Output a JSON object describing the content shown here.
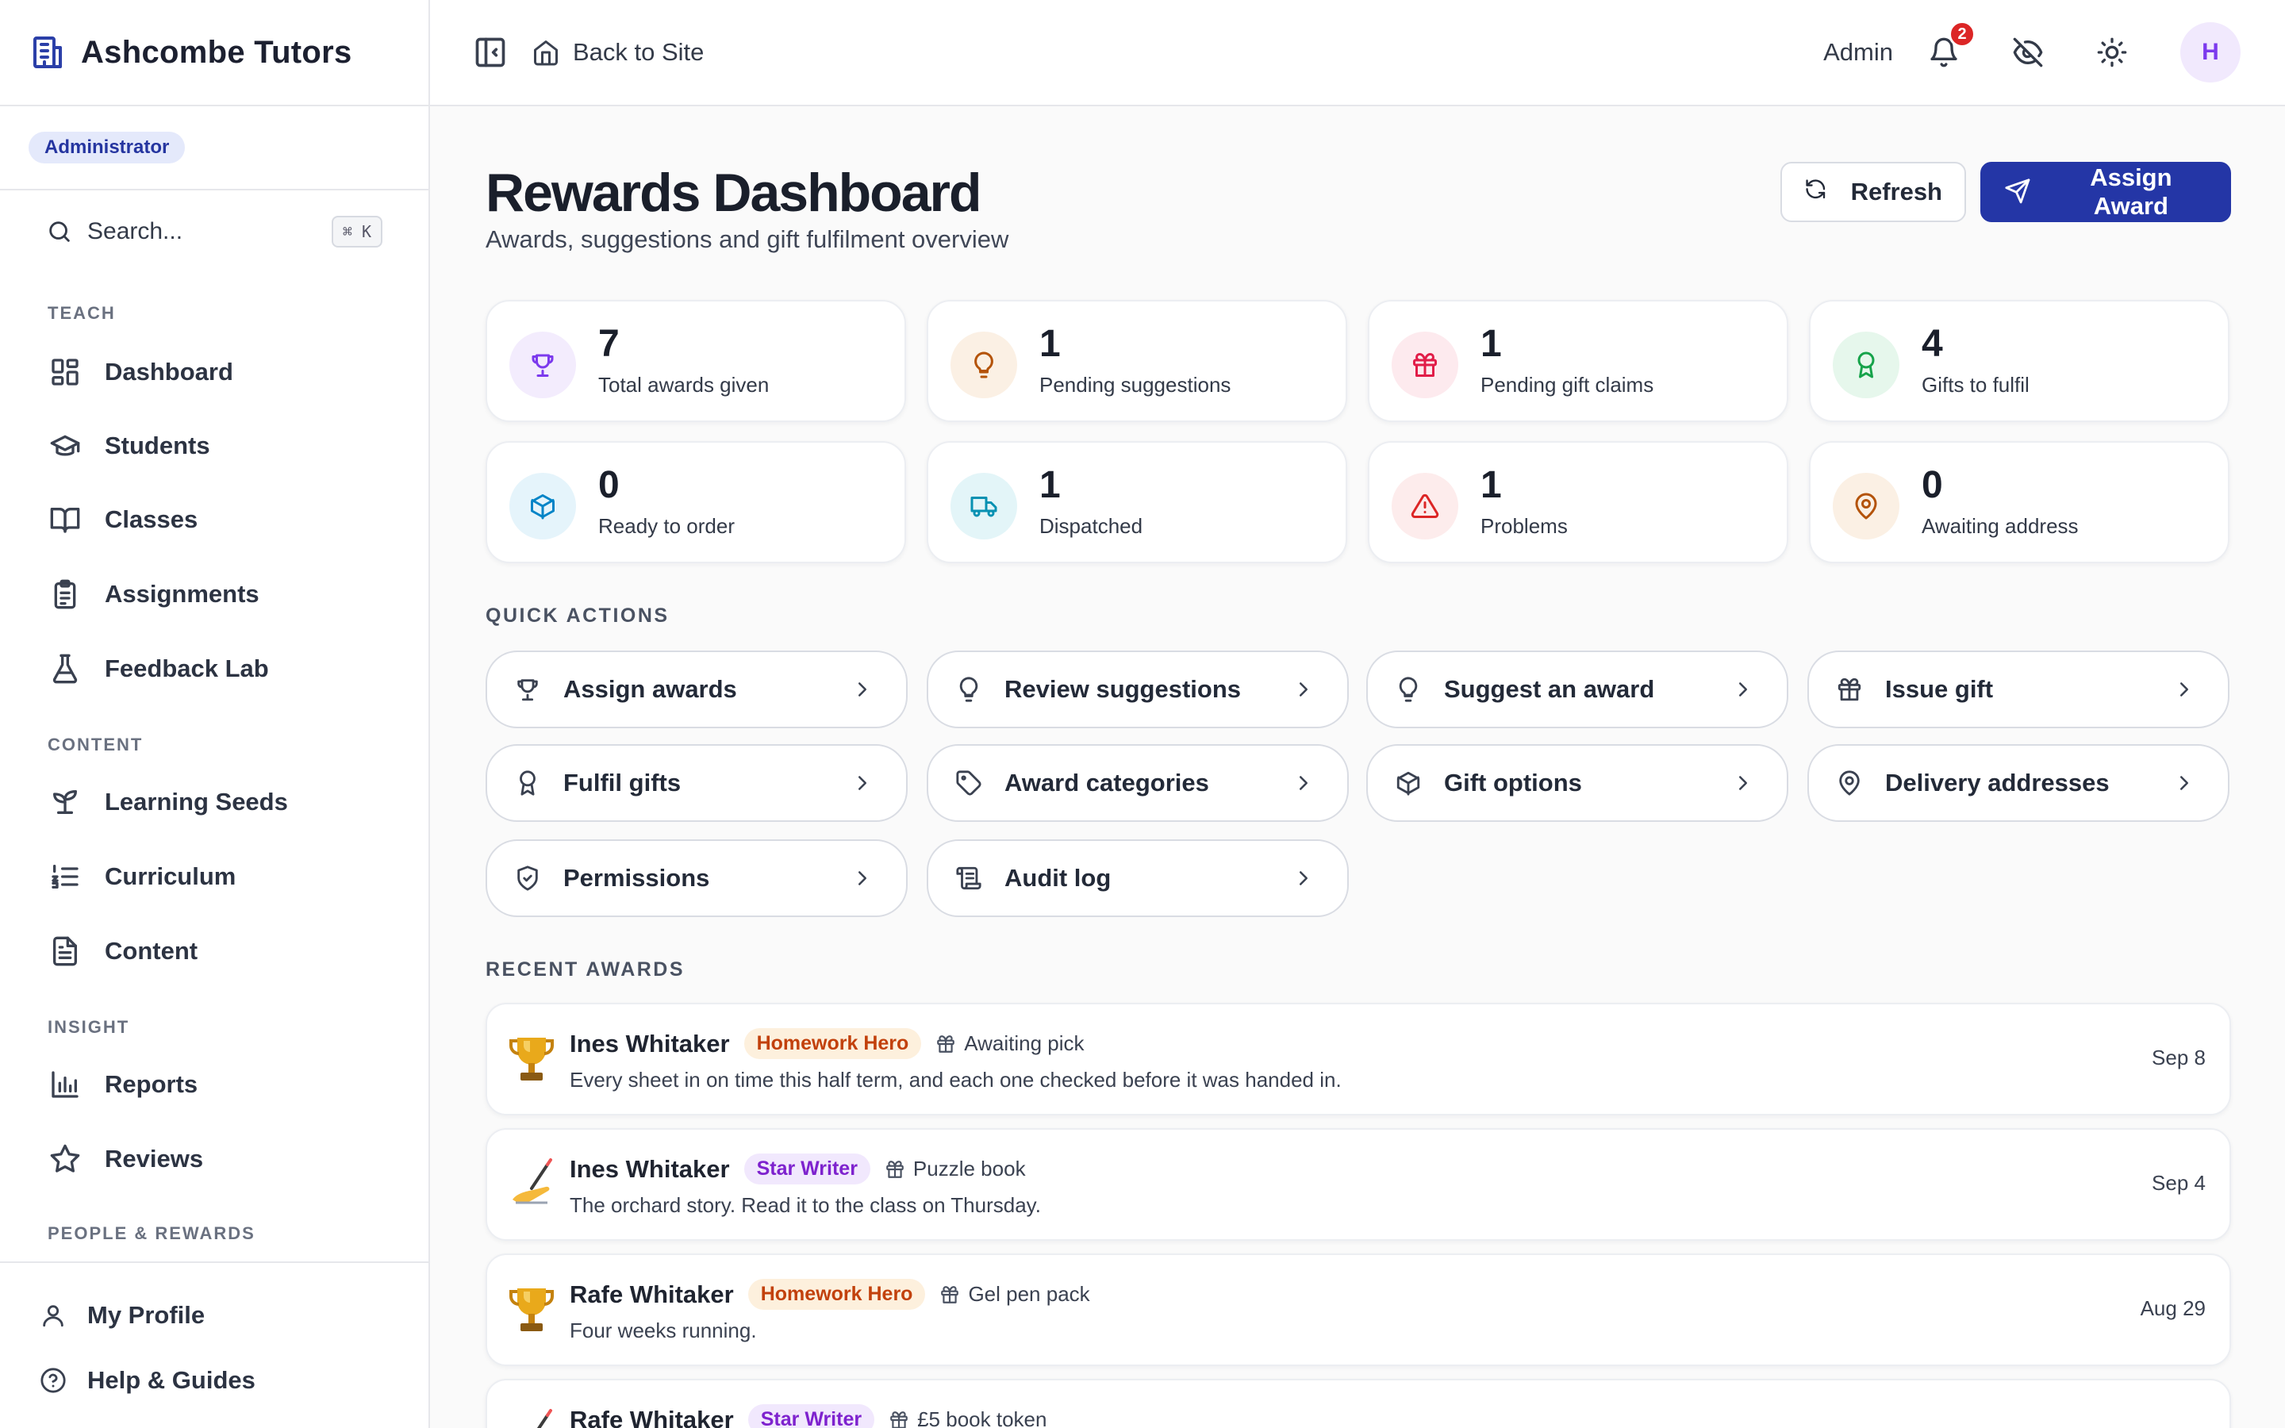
{
  "brand": {
    "name": "Ashcombe Tutors"
  },
  "role_badge": "Administrator",
  "search": {
    "placeholder": "Search...",
    "shortcut": "⌘ K"
  },
  "nav": {
    "sections": [
      "TEACH",
      "CONTENT",
      "INSIGHT",
      "PEOPLE & REWARDS"
    ],
    "items": [
      "Dashboard",
      "Students",
      "Classes",
      "Assignments",
      "Feedback Lab",
      "Learning Seeds",
      "Curriculum",
      "Content",
      "Reports",
      "Reviews"
    ],
    "icons": [
      "layout-grid-icon",
      "graduation-cap-icon",
      "open-book-icon",
      "clipboard-list-icon",
      "flask-icon",
      "sprout-icon",
      "list-ordered-icon",
      "file-text-icon",
      "bar-chart-icon",
      "star-icon"
    ]
  },
  "footer": {
    "profile": "My Profile",
    "help": "Help & Guides"
  },
  "topbar": {
    "back_to_site": "Back to Site",
    "admin_label": "Admin",
    "notification_count": "2",
    "avatar_initial": "H"
  },
  "page": {
    "title": "Rewards Dashboard",
    "subtitle": "Awards, suggestions and gift fulfilment overview"
  },
  "actions": {
    "refresh": "Refresh",
    "assign_award": "Assign Award"
  },
  "stats": [
    {
      "value": "7",
      "label": "Total awards given",
      "icon": "trophy-icon",
      "color": "#7c3aed",
      "bg": "#f3ecfd"
    },
    {
      "value": "1",
      "label": "Pending suggestions",
      "icon": "lightbulb-icon",
      "color": "#b45309",
      "bg": "#fbf0e4"
    },
    {
      "value": "1",
      "label": "Pending gift claims",
      "icon": "gift-icon",
      "color": "#e11d48",
      "bg": "#fdeaee"
    },
    {
      "value": "4",
      "label": "Gifts to fulfil",
      "icon": "award-ribbon-icon",
      "color": "#16a34a",
      "bg": "#e6f7ec"
    },
    {
      "value": "0",
      "label": "Ready to order",
      "icon": "package-icon",
      "color": "#0284c7",
      "bg": "#e5f4fb"
    },
    {
      "value": "1",
      "label": "Dispatched",
      "icon": "truck-icon",
      "color": "#0891b2",
      "bg": "#e3f5f8"
    },
    {
      "value": "1",
      "label": "Problems",
      "icon": "warning-triangle-icon",
      "color": "#dc2626",
      "bg": "#fdecec"
    },
    {
      "value": "0",
      "label": "Awaiting address",
      "icon": "map-pin-icon",
      "color": "#b45309",
      "bg": "#fbf0e4"
    }
  ],
  "quick_actions": {
    "label": "QUICK ACTIONS",
    "items": [
      "Assign awards",
      "Review suggestions",
      "Suggest an award",
      "Issue gift",
      "Fulfil gifts",
      "Award categories",
      "Gift options",
      "Delivery addresses",
      "Permissions",
      "Audit log"
    ],
    "icons": [
      "trophy-icon",
      "lightbulb-icon",
      "lightbulb-icon",
      "gift-icon",
      "award-ribbon-icon",
      "tag-icon",
      "package-icon",
      "map-pin-icon",
      "shield-check-icon",
      "scroll-icon"
    ]
  },
  "recent_awards": {
    "label": "RECENT AWARDS",
    "items": [
      {
        "emoji": "trophy-emoji",
        "name": "Ines Whitaker",
        "category": "Homework Hero",
        "gift": "Awaiting pick",
        "note": "Every sheet in on time this half term, and each one checked before it was handed in.",
        "date": "Sep 8"
      },
      {
        "emoji": "writing-hand-emoji",
        "name": "Ines Whitaker",
        "category": "Star Writer",
        "gift": "Puzzle book",
        "note": "The orchard story. Read it to the class on Thursday.",
        "date": "Sep 4"
      },
      {
        "emoji": "trophy-emoji",
        "name": "Rafe Whitaker",
        "category": "Homework Hero",
        "gift": "Gel pen pack",
        "note": "Four weeks running.",
        "date": "Aug 29"
      },
      {
        "emoji": "writing-hand-emoji",
        "name": "Rafe Whitaker",
        "category": "Star Writer",
        "gift": "£5 book token",
        "note": "",
        "date": ""
      }
    ]
  }
}
